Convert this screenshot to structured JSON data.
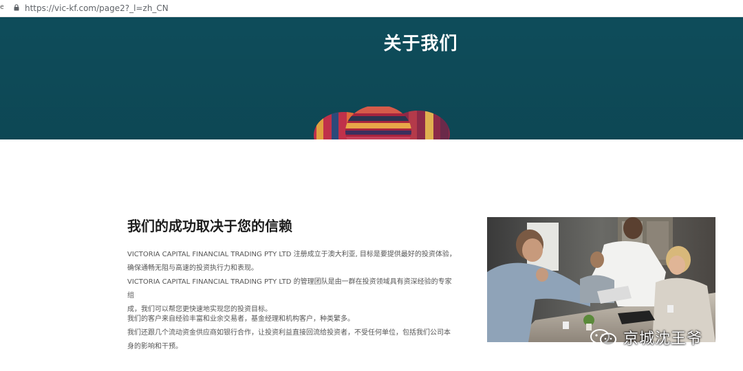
{
  "browser": {
    "url": "https://vic-kf.com/page2?_l=zh_CN",
    "edge_glyph": "e"
  },
  "hero": {
    "title": "关于我们",
    "background_color": "#0f5160"
  },
  "about": {
    "heading": "我们的成功取决于您的信赖",
    "paragraph_1": [
      "VICTORIA CAPITAL FINANCIAL TRADING PTY LTD 注册成立于澳大利亚, 目标是要提供最好的投资体验，",
      "确保通畅无阻与高速的投资执行力和表现。",
      "VICTORIA CAPITAL FINANCIAL TRADING PTY LTD 的管理团队是由一群在投资领域具有资深经验的专家组",
      "成，我们可以帮您更快速地实现您的投资目标。"
    ],
    "paragraph_2": [
      "我们的客户来自经验丰富和业余交易者，基金经理和机构客户，种类繁多。",
      "我们还跟几个流动资金供应商如银行合作，让投资利益直接回流给投资者，不受任何单位，包括我们公司本",
      "身的影响和干预。"
    ]
  },
  "watermark": {
    "text": "京城沈王爷",
    "icon": "wechat-icon"
  }
}
